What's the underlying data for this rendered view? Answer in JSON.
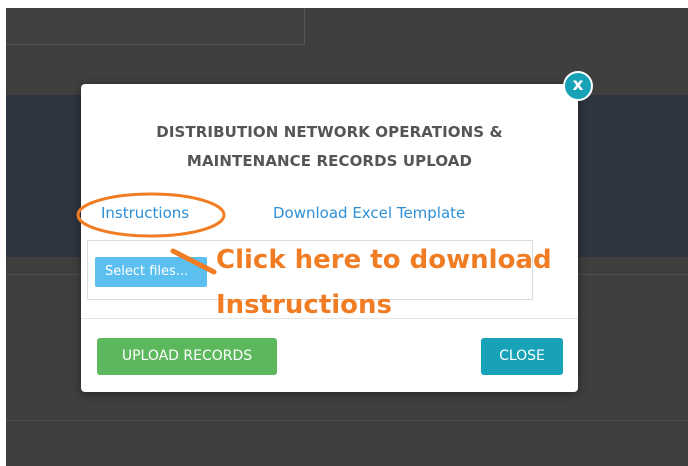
{
  "modal": {
    "title_line1": "DISTRIBUTION NETWORK OPERATIONS &",
    "title_line2": "MAINTENANCE RECORDS UPLOAD",
    "close_x_label": "x",
    "instructions_link": "Instructions",
    "template_link": "Download Excel Template",
    "select_files_label": "Select files...",
    "upload_button": "UPLOAD RECORDS",
    "close_button": "CLOSE"
  },
  "annotation": {
    "line1": "Click here to download",
    "line2": "Instructions",
    "color": "#f07d23"
  },
  "colors": {
    "link": "#2d8fd5",
    "upload_button": "#5cb85c",
    "close_button": "#17a2b8",
    "select_files": "#5bc0ef"
  }
}
